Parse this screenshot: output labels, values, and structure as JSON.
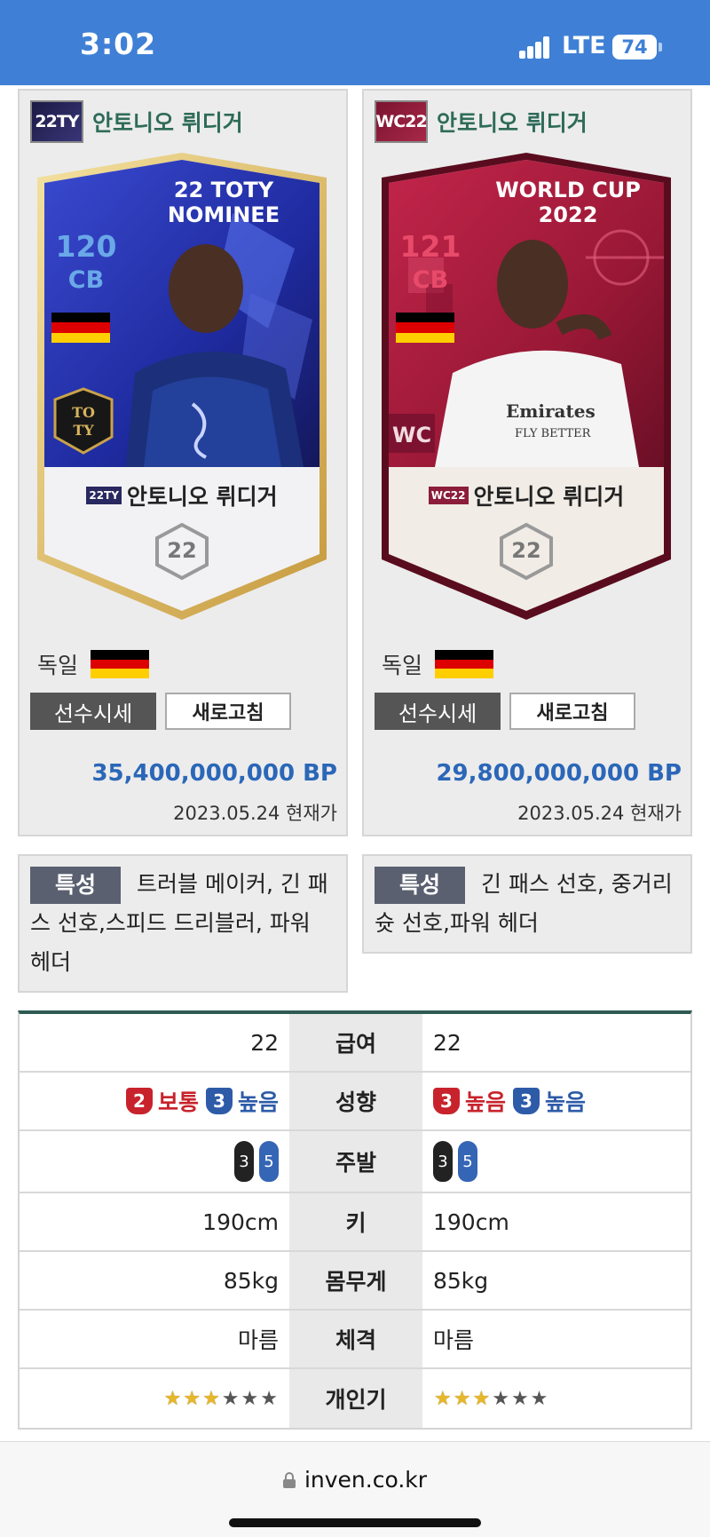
{
  "status_bar": {
    "time": "3:02",
    "network": "LTE",
    "battery": "74"
  },
  "players": [
    {
      "badge": "22TY",
      "name": "안토니오 뤼디거",
      "card": {
        "ovr": "120",
        "pos": "CB",
        "top_text": "22 TOTY\nNOMINEE",
        "mini_badge": "22TY",
        "name": "안토니오 뤼디거",
        "number": "22"
      },
      "nation_label": "독일",
      "price_button": "선수시세",
      "refresh_button": "새로고침",
      "price": "35,400,000,000 BP",
      "price_date": "2023.05.24 현재가",
      "trait_tag": "특성",
      "traits_text": "트러블 메이커, 긴 패스 선호,스피드 드리블러, 파워 헤더"
    },
    {
      "badge": "WC22",
      "name": "안토니오 뤼디거",
      "card": {
        "ovr": "121",
        "pos": "CB",
        "top_text": "WORLD CUP\n2022",
        "mini_badge": "WC22",
        "name": "안토니오 뤼디거",
        "number": "22"
      },
      "nation_label": "독일",
      "price_button": "선수시세",
      "refresh_button": "새로고침",
      "price": "29,800,000,000 BP",
      "price_date": "2023.05.24 현재가",
      "trait_tag": "특성",
      "traits_text": "긴 패스 선호, 중거리 슛 선호,파워 헤더"
    }
  ],
  "stats": {
    "salary": {
      "label": "급여",
      "left": "22",
      "right": "22"
    },
    "tendency": {
      "label": "성향",
      "left": [
        {
          "level": "2",
          "text": "보통",
          "color": "red"
        },
        {
          "level": "3",
          "text": "높음",
          "color": "blue"
        }
      ],
      "right": [
        {
          "level": "3",
          "text": "높음",
          "color": "red"
        },
        {
          "level": "3",
          "text": "높음",
          "color": "blue"
        }
      ]
    },
    "foot": {
      "label": "주발",
      "left": [
        "3",
        "5"
      ],
      "right": [
        "3",
        "5"
      ]
    },
    "height": {
      "label": "키",
      "left": "190cm",
      "right": "190cm"
    },
    "weight": {
      "label": "몸무게",
      "left": "85kg",
      "right": "85kg"
    },
    "build": {
      "label": "체격",
      "left": "마름",
      "right": "마름"
    },
    "popularity": {
      "label": "개인기",
      "left_stars": 3,
      "right_stars": 3,
      "max_stars": 6
    }
  },
  "browser": {
    "url": "inven.co.kr"
  },
  "colors": {
    "status_bar": "#3f80d6",
    "player_name": "#2e6b58",
    "price": "#2b67b8",
    "table_top_border": "#2f5a53",
    "red_level": "#c8232c",
    "blue_level": "#2d5ba8",
    "germany_flag": [
      "#000000",
      "#dd0000",
      "#ffce00"
    ]
  }
}
